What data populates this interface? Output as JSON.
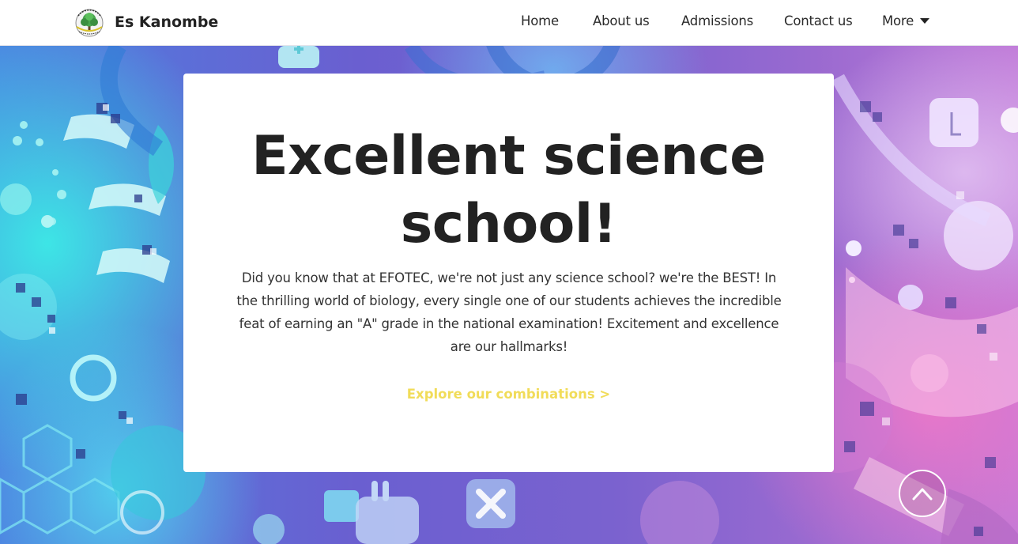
{
  "header": {
    "brand_name": "Es Kanombe",
    "nav": [
      {
        "label": "Home"
      },
      {
        "label": "About us"
      },
      {
        "label": "Admissions"
      },
      {
        "label": "Contact us"
      },
      {
        "label": "More"
      }
    ]
  },
  "hero": {
    "headline_line1": "Excellent science",
    "headline_line2": "school!",
    "body": "Did you know that at EFOTEC, we're not just any science school? we're the BEST! In the thrilling world of biology, every single one of our students achieves the incredible feat of earning an \"A\" grade in the national examination! Excitement and excellence are our hallmarks!",
    "cta_label": "Explore our combinations >"
  },
  "icons": {
    "logo": "school-logo-icon",
    "dropdown": "caret-down-icon",
    "scroll_top": "chevron-up-icon"
  },
  "colors": {
    "cta": "#f1dc59",
    "headline": "#222222",
    "header_bg": "#ffffff"
  }
}
